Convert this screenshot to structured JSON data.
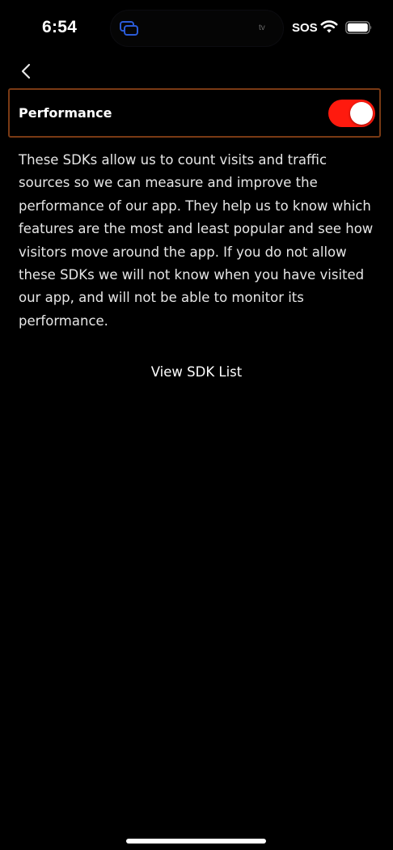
{
  "status_bar": {
    "time": "6:54",
    "island_label": "tv",
    "sos": "SOS",
    "icons": [
      "screen-mirroring-icon",
      "wifi-icon",
      "battery-icon"
    ]
  },
  "navigation": {
    "back_icon": "chevron-left-icon"
  },
  "performance": {
    "label": "Performance",
    "toggle_on": true,
    "toggle_color": "#ff1a0e",
    "border_color": "#7a3a14"
  },
  "description": "These SDKs allow us to count visits and traffic sources so we can measure and improve the performance of our app. They help us to know which features are the most and least popular and see how visitors move around the app. If you do not allow these SDKs we will not know when you have visited our app, and will not be able to monitor its performance.",
  "view_sdk_list_label": "View SDK List"
}
